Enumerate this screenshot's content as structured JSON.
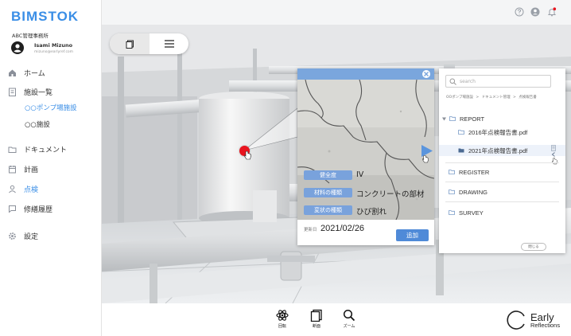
{
  "app": {
    "brand": "BIMSTOK",
    "office": "ABC管理事務所",
    "user_name": "Isami Mizuno",
    "user_email": "mizuno@earlyref.com",
    "accent": "#3a8ee6"
  },
  "sidebar": {
    "items": [
      {
        "label": "ホーム",
        "icon": "home-icon"
      },
      {
        "label": "施設一覧",
        "icon": "building-list-icon"
      },
      {
        "label": "ドキュメント",
        "icon": "folder-icon"
      },
      {
        "label": "計画",
        "icon": "calendar-icon"
      },
      {
        "label": "点検",
        "icon": "person-icon",
        "active": true
      },
      {
        "label": "修繕履歴",
        "icon": "chat-icon"
      },
      {
        "label": "設定",
        "icon": "gear-icon"
      }
    ],
    "subitems": [
      {
        "label": "○○ポンプ場施設",
        "active": true
      },
      {
        "label": "○○施設"
      }
    ]
  },
  "topbar": {
    "icons": [
      "help-icon",
      "account-icon",
      "notification-bell-icon"
    ]
  },
  "viewer": {
    "toggle": [
      "panel-icon",
      "menu-icon"
    ]
  },
  "popup": {
    "updated_label": "更新日",
    "updated_date": "2021/02/26",
    "properties": [
      {
        "label": "健全度",
        "value": "IV"
      },
      {
        "label": "材料の種類",
        "value": "コンクリートの部材"
      },
      {
        "label": "変状の種類",
        "value": "ひび割れ"
      }
    ],
    "add_label": "追加"
  },
  "docs": {
    "search_placeholder": "search",
    "breadcrumbs": [
      "OOポンプ場施設",
      ">",
      "ドキュメント管理",
      ">",
      "点検報告書"
    ],
    "folders": [
      {
        "label": "REPORT",
        "expanded": true
      },
      {
        "label": "2016年点検報告書.pdf",
        "type": "file"
      },
      {
        "label": "2021年点検報告書.pdf",
        "type": "file",
        "selected": true
      },
      {
        "label": "REGISTER"
      },
      {
        "label": "DRAWING"
      },
      {
        "label": "SURVEY"
      }
    ],
    "close_label": "閉じる"
  },
  "bottom_tools": [
    {
      "label": "回転",
      "icon": "rotate-atom-icon"
    },
    {
      "label": "断面",
      "icon": "section-icon"
    },
    {
      "label": "ズーム",
      "icon": "zoom-icon"
    }
  ],
  "logo": {
    "line1": "Early",
    "line2": "Reflections"
  }
}
